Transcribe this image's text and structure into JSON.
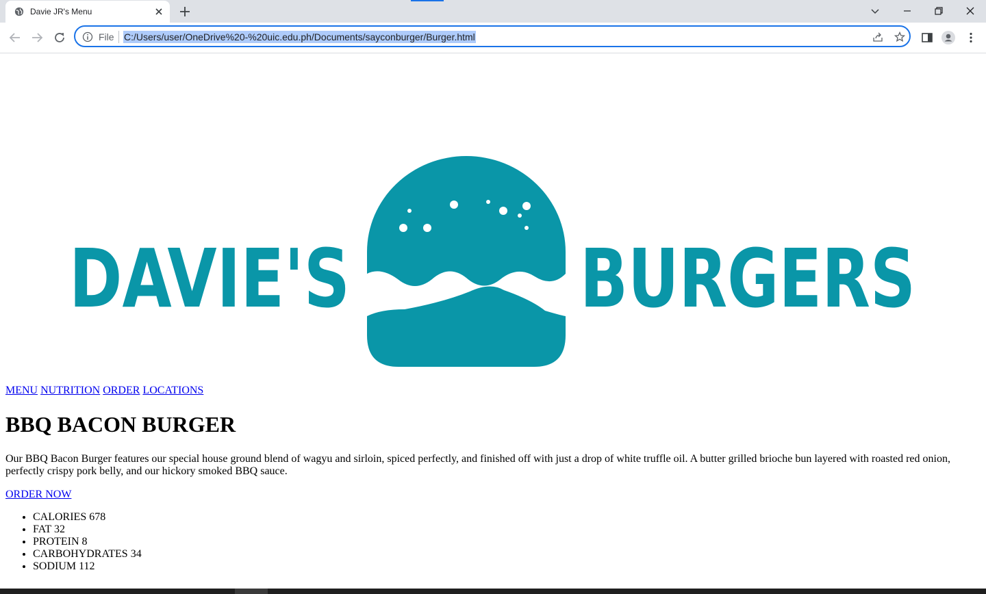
{
  "browser": {
    "tab_title": "Davie JR's Menu",
    "file_label": "File",
    "url": "C:/Users/user/OneDrive%20-%20uic.edu.ph/Documents/sayconburger/Burger.html"
  },
  "logo": {
    "left_word": "DAVIE'S",
    "right_word": "BURGERS",
    "brand_color": "#0a96a8"
  },
  "nav": {
    "items": [
      "MENU",
      "NUTRITION",
      "ORDER",
      "LOCATIONS"
    ]
  },
  "product": {
    "title": "BBQ BACON BURGER",
    "description": "Our BBQ Bacon Burger features our special house ground blend of wagyu and sirloin, spiced perfectly, and finished off with just a drop of white truffle oil. A butter grilled brioche bun layered with roasted red onion, perfectly crispy pork belly, and our hickory smoked BBQ sauce.",
    "order_label": "ORDER NOW",
    "nutrition": [
      "CALORIES 678",
      "FAT 32",
      "PROTEIN 8",
      "CARBOHYDRATES 34",
      "SODIUM 112"
    ]
  },
  "colors": {
    "link": "#0000ee",
    "focus": "#1a73e8",
    "tabstrip": "#dee1e6"
  }
}
